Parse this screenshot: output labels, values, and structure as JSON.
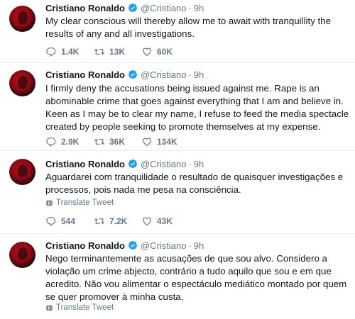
{
  "author": {
    "name": "Cristiano Ronaldo",
    "handle": "@Cristiano",
    "time": "9h"
  },
  "translate_label": "Translate Tweet",
  "tweets": [
    {
      "text": "My clear conscious will thereby allow me to await with tranquillity the results of any and all investigations.",
      "replies": "1.4K",
      "retweets": "13K",
      "likes": "60K"
    },
    {
      "text": "I firmly deny the accusations being issued against me. Rape is an abominable crime that goes against everything that I am and believe in. Keen as I may be to clear my name, I refuse to feed the media spectacle created by people seeking to promote themselves at my expense.",
      "replies": "2.9K",
      "retweets": "36K",
      "likes": "134K"
    },
    {
      "text": "Aguardarei com tranquilidade o resultado de quaisquer investigações e processos, pois nada me pesa na consciência.",
      "replies": "544",
      "retweets": "7.2K",
      "likes": "43K"
    },
    {
      "text": "Nego terminantemente as acusações de que sou alvo. Considero a violação um crime abjecto, contrário a tudo aquilo que sou e em que acredito. Não vou alimentar o espectáculo mediático montado por quem se quer promover à minha custa."
    }
  ],
  "colors": {
    "verified": "#1da1f2",
    "muted": "#657786",
    "divider": "#e6ecf0"
  }
}
